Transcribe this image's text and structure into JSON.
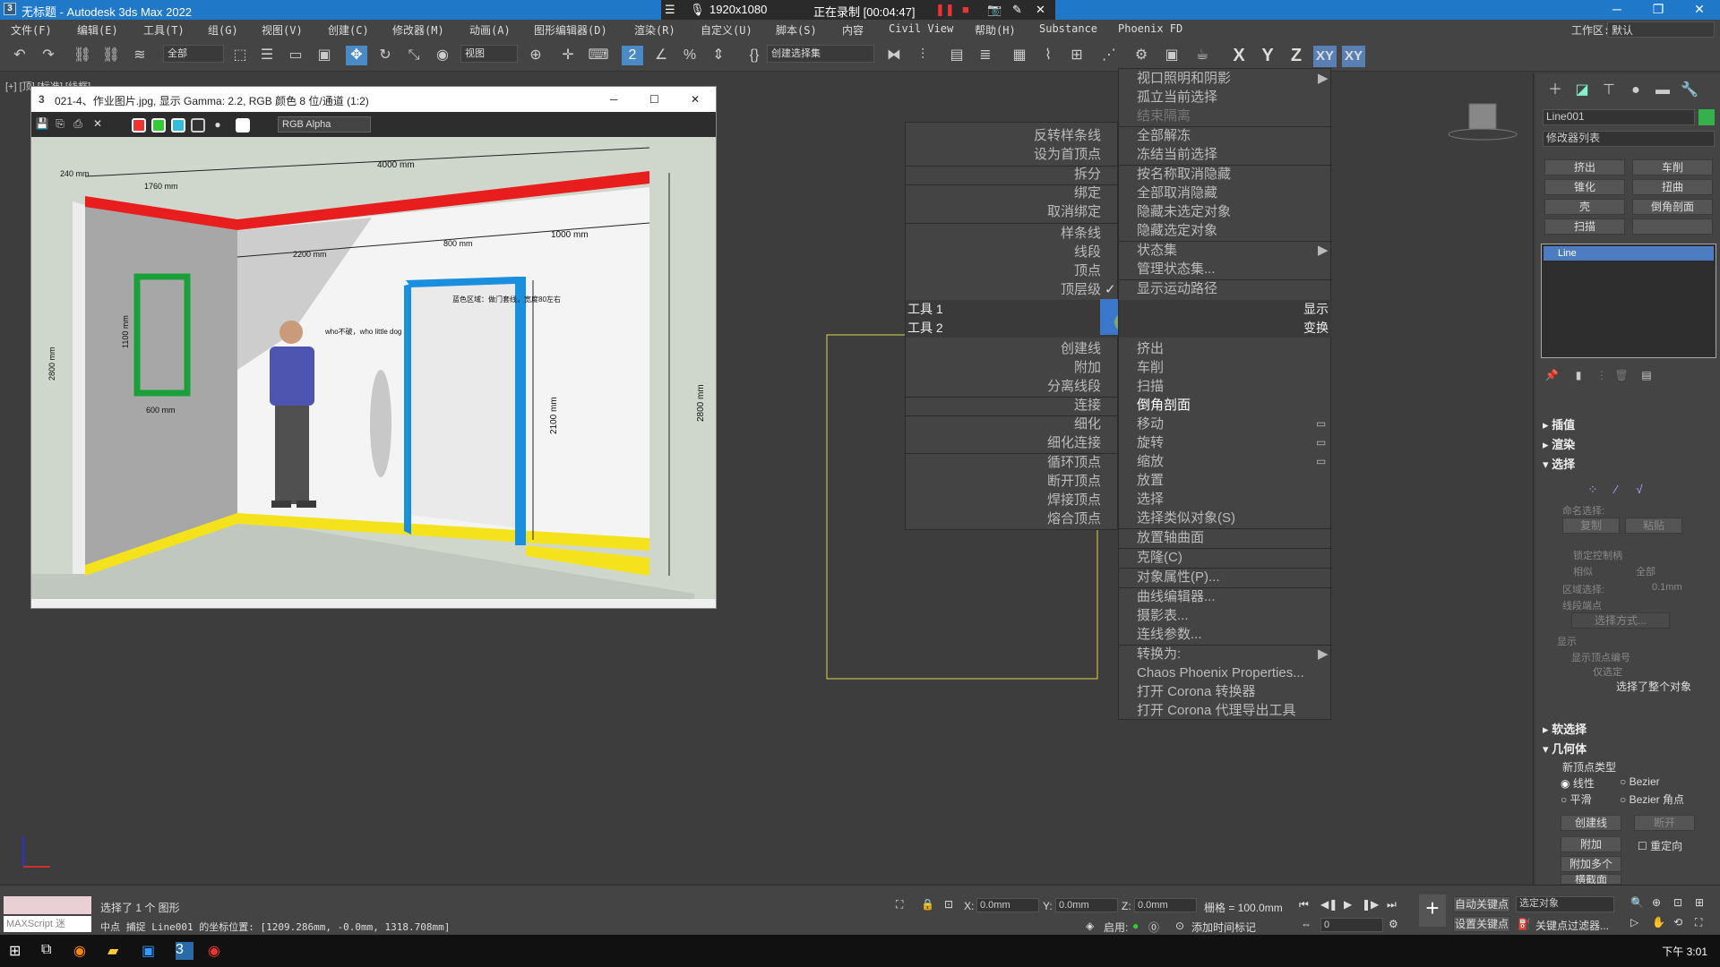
{
  "titlebar": {
    "title": "无标题 - Autodesk 3ds Max 2022",
    "rec_resolution": "1920x1080",
    "rec_status": "正在录制 [00:04:47]"
  },
  "menubar": {
    "items": [
      "文件(F)",
      "编辑(E)",
      "工具(T)",
      "组(G)",
      "视图(V)",
      "创建(C)",
      "修改器(M)",
      "动画(A)",
      "图形编辑器(D)",
      "渲染(R)",
      "自定义(U)",
      "脚本(S)",
      "内容",
      "Civil View",
      "帮助(H)",
      "Substance",
      "Phoenix FD"
    ],
    "workspace_label": "工作区:",
    "workspace_value": "默认"
  },
  "toolbar": {
    "filter_dropdown": "全部",
    "view_dropdown": "视图",
    "selection_set_dropdown": "创建选择集",
    "axes": [
      "X",
      "Y",
      "Z",
      "XY",
      "XY"
    ]
  },
  "viewport": {
    "label": "[+] [顶] [标准] [线框]"
  },
  "image_window": {
    "title": "021-4、作业图片.jpg, 显示 Gamma: 2.2, RGB 颜色 8 位/通道 (1:2)",
    "channel": "RGB Alpha",
    "annotations": {
      "dim_240": "240 mm",
      "dim_1760": "1760 mm",
      "dim_4000": "4000 mm",
      "dim_2200": "2200 mm",
      "dim_800": "800 mm",
      "dim_1000": "1000 mm",
      "dim_1100": "1100 mm",
      "dim_600": "600 mm",
      "dim_2800_left": "2800 mm",
      "dim_2800_right": "2800 mm",
      "dim_2100": "2100 mm",
      "note_blue": "蓝色区域：做门套线，宽度80左右",
      "person_note": "who不破，who little dog"
    }
  },
  "quad_left": {
    "items": [
      "反转样条线",
      "设为首顶点",
      "拆分",
      "绑定",
      "取消绑定",
      "样条线",
      "线段",
      "顶点",
      "顶层级",
      "创建线",
      "附加",
      "分离线段",
      "连接",
      "细化",
      "细化连接",
      "循环顶点",
      "断开顶点",
      "焊接顶点",
      "熔合顶点"
    ],
    "header1": "工具 1",
    "header2": "工具 2"
  },
  "quad_right": {
    "items_top": [
      "视口照明和阴影",
      "孤立当前选择",
      "结束隔离",
      "全部解冻",
      "冻结当前选择",
      "按名称取消隐藏",
      "全部取消隐藏",
      "隐藏未选定对象",
      "隐藏选定对象",
      "状态集",
      "管理状态集...",
      "显示运动路径"
    ],
    "header_display": "显示",
    "header_transform": "变换",
    "items_bottom": [
      "挤出",
      "车削",
      "扫描",
      "倒角剖面",
      "移动",
      "旋转",
      "缩放",
      "放置",
      "选择",
      "选择类似对象(S)",
      "放置轴曲面",
      "克隆(C)",
      "对象属性(P)...",
      "曲线编辑器...",
      "摄影表...",
      "连线参数...",
      "转换为:",
      "Chaos Phoenix Properties...",
      "打开 Corona 转换器",
      "打开 Corona 代理导出工具"
    ]
  },
  "command_panel": {
    "object_name": "Line001",
    "modifier_list": "修改器列表",
    "buttons": [
      "挤出",
      "车削",
      "锥化",
      "扭曲",
      "壳",
      "倒角剖面",
      "扫描",
      ""
    ],
    "stack_item": "Line",
    "sections": [
      "插值",
      "渲染",
      "选择",
      "软选择",
      "几何体"
    ],
    "select_sub": {
      "named_sel": "命名选择:",
      "copy": "复制",
      "paste": "粘贴",
      "lock_handles": "锁定控制柄",
      "similar": "相似",
      "all": "全部",
      "area_sel": "区域选择:",
      "area_val": "0.1mm",
      "segment_end": "线段端点",
      "select_by": "选择方式...",
      "display": "显示",
      "show_vert_num": "显示顶点编号",
      "only_selected": "仅选定",
      "whole_object": "选择了整个对象"
    },
    "geometry": {
      "new_vertex_type": "新顶点类型",
      "linear": "线性",
      "bezier": "Bezier",
      "smooth": "平滑",
      "bezier_corner": "Bezier 角点",
      "create_line": "创建线",
      "break": "断开",
      "attach": "附加",
      "reorient": "重定向",
      "attach_multi": "附加多个",
      "cross_section": "横截面"
    }
  },
  "statusbar": {
    "maxscript": "MAXScript 迷",
    "selected": "选择了 1 个 图形",
    "prompt": "中点 捕捉 Line001 的坐标位置: [1209.286mm, -0.0mm, 1318.708mm]",
    "x_label": "X:",
    "x_val": "0.0mm",
    "y_label": "Y:",
    "y_val": "0.0mm",
    "z_label": "Z:",
    "z_val": "0.0mm",
    "grid": "栅格 = 100.0mm",
    "enable": "启用:",
    "add_time_tag": "添加时间标记",
    "auto_key": "自动关键点",
    "set_key": "设置关键点",
    "selected_obj": "选定对象",
    "key_filters": "关键点过滤器...",
    "frame": "0"
  },
  "taskbar": {
    "time": "下午 3:01"
  }
}
